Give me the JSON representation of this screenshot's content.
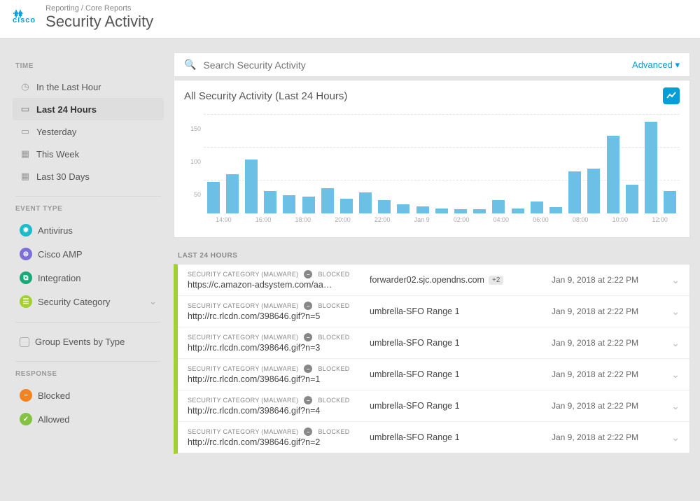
{
  "breadcrumb": "Reporting / Core Reports",
  "page_title": "Security Activity",
  "logo_text": "cisco",
  "search": {
    "placeholder": "Search Security Activity",
    "advanced_label": "Advanced"
  },
  "sidebar": {
    "time": {
      "title": "TIME",
      "items": [
        {
          "label": "In the Last Hour",
          "active": false
        },
        {
          "label": "Last 24 Hours",
          "active": true
        },
        {
          "label": "Yesterday",
          "active": false
        },
        {
          "label": "This Week",
          "active": false
        },
        {
          "label": "Last 30 Days",
          "active": false
        }
      ]
    },
    "event_type": {
      "title": "EVENT TYPE",
      "items": [
        {
          "label": "Antivirus"
        },
        {
          "label": "Cisco AMP"
        },
        {
          "label": "Integration"
        },
        {
          "label": "Security Category"
        }
      ],
      "group_by": "Group Events by Type"
    },
    "response": {
      "title": "RESPONSE",
      "items": [
        {
          "label": "Blocked"
        },
        {
          "label": "Allowed"
        }
      ]
    }
  },
  "chart_title": "All Security Activity (Last 24 Hours)",
  "chart_data": {
    "type": "bar",
    "title": "All Security Activity (Last 24 Hours)",
    "xlabel": "",
    "ylabel": "",
    "ylim": [
      0,
      160
    ],
    "categories": [
      "13:00",
      "14:00",
      "15:00",
      "16:00",
      "17:00",
      "18:00",
      "19:00",
      "20:00",
      "21:00",
      "22:00",
      "23:00",
      "Jan 9",
      "01:00",
      "02:00",
      "03:00",
      "04:00",
      "05:00",
      "06:00",
      "07:00",
      "08:00",
      "09:00",
      "10:00",
      "11:00",
      "12:00",
      "13:00"
    ],
    "values": [
      48,
      60,
      82,
      34,
      28,
      26,
      38,
      22,
      32,
      20,
      14,
      11,
      8,
      6,
      6,
      20,
      8,
      18,
      10,
      64,
      68,
      118,
      44,
      140,
      34
    ],
    "tick_labels": [
      "14:00",
      "16:00",
      "18:00",
      "20:00",
      "22:00",
      "Jan 9",
      "02:00",
      "04:00",
      "06:00",
      "08:00",
      "10:00",
      "12:00"
    ],
    "y_ticks": [
      50,
      100,
      150
    ]
  },
  "events_title": "LAST 24 HOURS",
  "event_meta": {
    "category": "SECURITY CATEGORY (MALWARE)",
    "status": "BLOCKED"
  },
  "events": [
    {
      "url": "https://c.amazon-adsystem.com/aa…",
      "identity": "forwarder02.sjc.opendns.com",
      "extra": "+2",
      "time": "Jan 9, 2018 at 2:22 PM"
    },
    {
      "url": "http://rc.rlcdn.com/398646.gif?n=5",
      "identity": "umbrella-SFO Range 1",
      "time": "Jan 9, 2018 at 2:22 PM"
    },
    {
      "url": "http://rc.rlcdn.com/398646.gif?n=3",
      "identity": "umbrella-SFO Range 1",
      "time": "Jan 9, 2018 at 2:22 PM"
    },
    {
      "url": "http://rc.rlcdn.com/398646.gif?n=1",
      "identity": "umbrella-SFO Range 1",
      "time": "Jan 9, 2018 at 2:22 PM"
    },
    {
      "url": "http://rc.rlcdn.com/398646.gif?n=4",
      "identity": "umbrella-SFO Range 1",
      "time": "Jan 9, 2018 at 2:22 PM"
    },
    {
      "url": "http://rc.rlcdn.com/398646.gif?n=2",
      "identity": "umbrella-SFO Range 1",
      "time": "Jan 9, 2018 at 2:22 PM"
    }
  ]
}
